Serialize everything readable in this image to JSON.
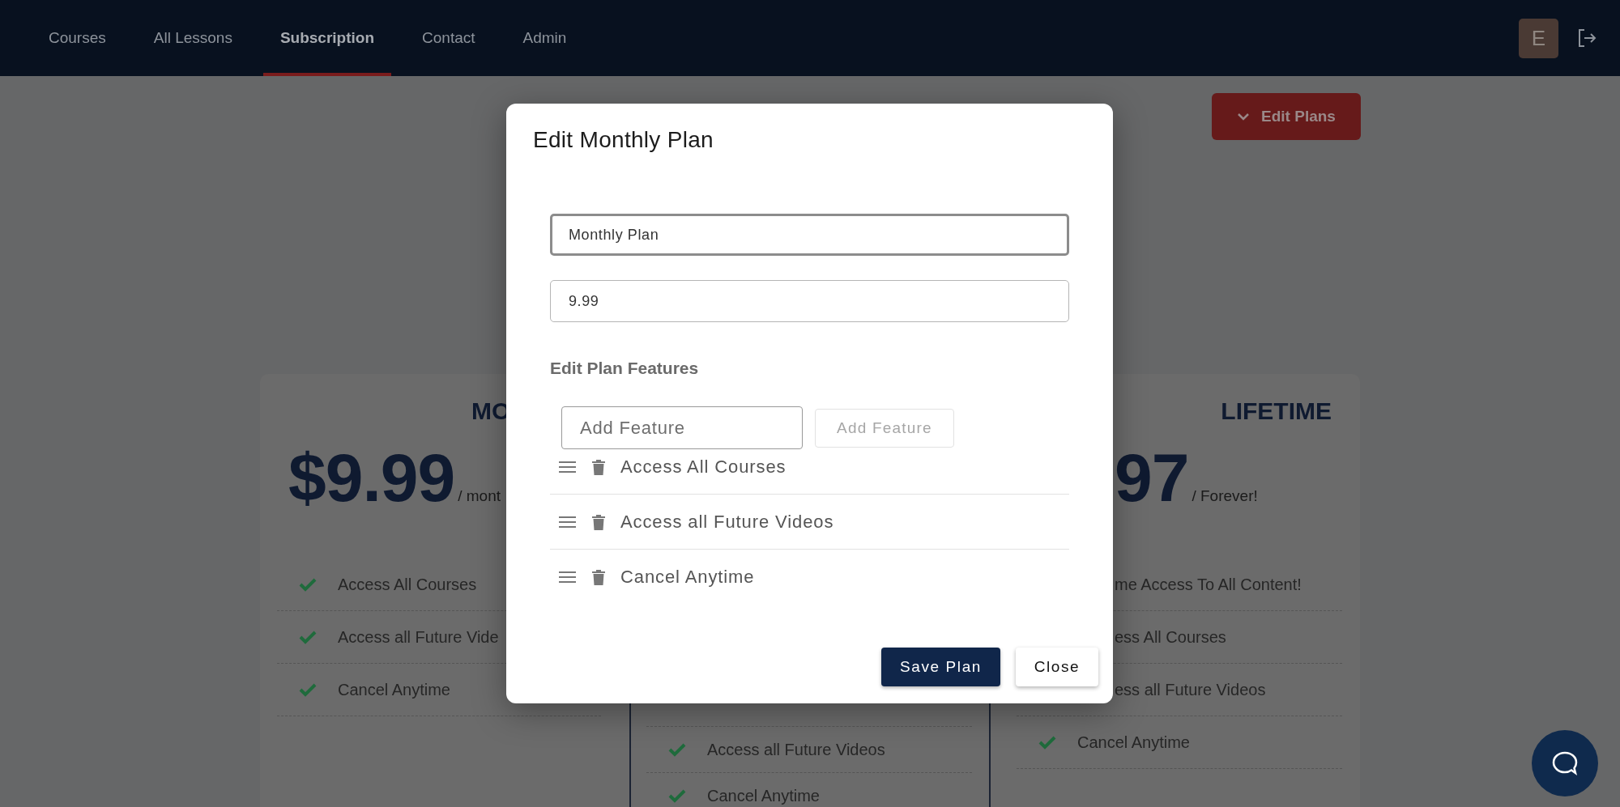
{
  "nav": {
    "items": [
      {
        "label": "Courses",
        "selected": false
      },
      {
        "label": "All Lessons",
        "selected": false
      },
      {
        "label": "Subscription",
        "selected": true
      },
      {
        "label": "Contact",
        "selected": false
      },
      {
        "label": "Admin",
        "selected": false
      }
    ],
    "avatar": "E"
  },
  "edit_plans_button": "Edit Plans",
  "plans": [
    {
      "title": "MO",
      "price": "$9.99",
      "period": "/ mont",
      "featured": false,
      "features": [
        {
          "text": "Access All Courses",
          "check_visible": true
        },
        {
          "text": "Access all Future Vide",
          "check_visible": true
        },
        {
          "text": "Cancel Anytime",
          "check_visible": true
        }
      ]
    },
    {
      "featured": true,
      "features": [
        {
          "text": "Access all Future Videos",
          "check_visible": true
        },
        {
          "text": "Cancel Anytime",
          "check_visible": true
        }
      ]
    },
    {
      "title": "LIFETIME",
      "price": "97",
      "period": "/ Forever!",
      "featured": false,
      "features": [
        {
          "text": "me Access To All Content!",
          "check_visible": false
        },
        {
          "text": "ess All Courses",
          "check_visible": false
        },
        {
          "text": "ess all Future Videos",
          "check_visible": false
        },
        {
          "text": "Cancel Anytime",
          "check_visible": true
        }
      ]
    }
  ],
  "modal": {
    "title": "Edit Monthly Plan",
    "name_field": {
      "value": "Monthly Plan",
      "focused": true
    },
    "price_field": {
      "value": "9.99",
      "focused": false
    },
    "features_heading": "Edit Plan Features",
    "new_feature_field": {
      "placeholder": "Add Feature"
    },
    "add_button": {
      "label": "Add Feature",
      "disabled": true
    },
    "features": [
      "Access All Courses",
      "Access all Future Videos",
      "Cancel Anytime"
    ],
    "buttons": [
      {
        "label": "Save Plan",
        "kind": "primary"
      },
      {
        "label": "Close",
        "kind": "secondary"
      }
    ]
  }
}
